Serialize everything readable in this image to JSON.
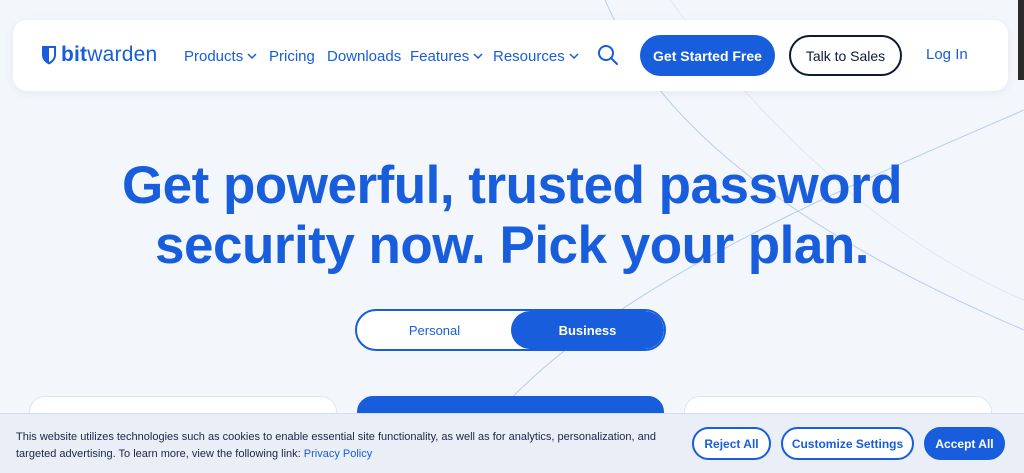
{
  "brand": {
    "logo_bold": "bit",
    "logo_rest": "warden",
    "accent": "#175ddc",
    "dark": "#0c1a36"
  },
  "nav": {
    "items": [
      {
        "label": "Products",
        "has_dropdown": true
      },
      {
        "label": "Pricing",
        "has_dropdown": false
      },
      {
        "label": "Downloads",
        "has_dropdown": false
      },
      {
        "label": "Features",
        "has_dropdown": true
      },
      {
        "label": "Resources",
        "has_dropdown": true
      }
    ],
    "search_icon": "search-icon",
    "get_started": "Get Started Free",
    "talk_to_sales": "Talk to Sales",
    "login": "Log In"
  },
  "hero": {
    "title_line1": "Get powerful, trusted password",
    "title_line2": "security now. Pick your plan."
  },
  "plan_toggle": {
    "personal": "Personal",
    "business": "Business",
    "selected": "Business"
  },
  "cookie": {
    "text": "This website utilizes technologies such as cookies to enable essential site functionality, as well as for analytics, personalization, and targeted advertising. To learn more, view the following link: ",
    "link": "Privacy Policy",
    "reject": "Reject All",
    "customize": "Customize Settings",
    "accept": "Accept All"
  }
}
